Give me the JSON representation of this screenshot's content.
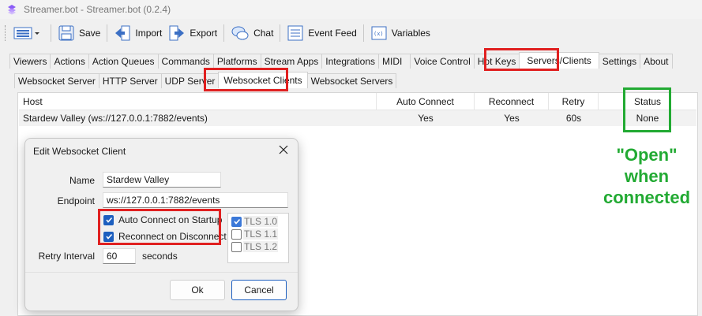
{
  "window": {
    "title": "Streamer.bot - Streamer.bot (0.2.4)"
  },
  "toolbar": {
    "save": "Save",
    "import": "Import",
    "export": "Export",
    "chat": "Chat",
    "event_feed": "Event Feed",
    "variables": "Variables"
  },
  "main_tabs": [
    "Viewers",
    "Actions",
    "Action Queues",
    "Commands",
    "Platforms",
    "Stream Apps",
    "Integrations",
    "MIDI",
    "Voice Control",
    "Hot Keys",
    "Servers/Clients",
    "Settings",
    "About"
  ],
  "sub_tabs": [
    "Websocket Server",
    "HTTP Server",
    "UDP Server",
    "Websocket Clients",
    "Websocket Servers"
  ],
  "grid": {
    "headers": {
      "host": "Host",
      "auto_connect": "Auto Connect",
      "reconnect": "Reconnect",
      "retry": "Retry",
      "status": "Status"
    },
    "rows": [
      {
        "host": "Stardew Valley (ws://127.0.0.1:7882/events)",
        "auto_connect": "Yes",
        "reconnect": "Yes",
        "retry": "60s",
        "status": "None"
      }
    ]
  },
  "annotation": {
    "line1": "\"Open\"",
    "line2": "when",
    "line3": "connected"
  },
  "dialog": {
    "title": "Edit Websocket Client",
    "name_label": "Name",
    "name_value": "Stardew Valley",
    "endpoint_label": "Endpoint",
    "endpoint_value": "ws://127.0.0.1:7882/events",
    "auto_connect_label": "Auto Connect on Startup",
    "reconnect_label": "Reconnect on Disconnect",
    "retry_label": "Retry Interval",
    "retry_value": "60",
    "retry_unit": "seconds",
    "tls": [
      {
        "label": "TLS 1.0",
        "checked": true
      },
      {
        "label": "TLS 1.1",
        "checked": false
      },
      {
        "label": "TLS 1.2",
        "checked": false
      }
    ],
    "ok": "Ok",
    "cancel": "Cancel"
  },
  "colors": {
    "highlight_red": "#e02020",
    "highlight_green": "#22aa33",
    "checkbox_blue": "#1d5fbf"
  }
}
